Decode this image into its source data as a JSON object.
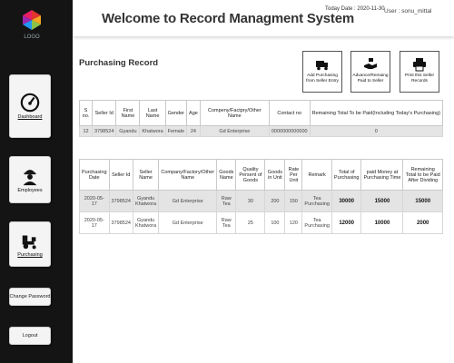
{
  "sidebar": {
    "logo_text": "LOGO",
    "items": [
      {
        "label": "Dashboard",
        "icon": "gauge-icon"
      },
      {
        "label": "Employees",
        "icon": "worker-icon"
      },
      {
        "label": "Purchasing",
        "icon": "tractor-icon"
      },
      {
        "label": "Change Password"
      },
      {
        "label": "Logout"
      }
    ]
  },
  "header": {
    "title": "Welcome to Record Managment System",
    "today": "Today Date : 2020-11-30",
    "user": "User : sonu_mittal"
  },
  "page": {
    "section_title": "Purchasing Record",
    "actions": [
      {
        "label": "Add Purchasing from Seller Entry",
        "icon": "truck-icon"
      },
      {
        "label": "Advance/Remaing Paid to Seller",
        "icon": "handshake-icon"
      },
      {
        "label": "Print this Seller Records",
        "icon": "printer-icon"
      }
    ]
  },
  "seller_table": {
    "headers": [
      "S no.",
      "Seller Id",
      "First Name",
      "Last Name",
      "Gender",
      "Age",
      "Compeny/Factpry/Other Name",
      "Contact no",
      "Remaining Total To be Paid(Including Today's Purchasing)"
    ],
    "rows": [
      [
        "12",
        "3798524",
        "Gyandu",
        "Khatwora",
        "Female",
        "24",
        "Gd Enterprise",
        "0000000000000",
        "0"
      ]
    ]
  },
  "purchase_table": {
    "headers": [
      "Purchasing Date",
      "Seller Id",
      "Seller Name",
      "Company/Factory/Other Name",
      "Goods Name",
      "Quality Persent of Goods",
      "Goods in Unit",
      "Rate Per Unit",
      "Remark",
      "Total of Purchasing",
      "paid Money at Purchasing Time",
      "Remaining Total to be Paid After Dividing"
    ],
    "rows": [
      [
        "2020-05-17",
        "3798524",
        "Gyandu Khatwora",
        "Gd Enterprise",
        "Raw Tea",
        "30",
        "200",
        "150",
        "Tea Purchasing",
        "30000",
        "15000",
        "15000"
      ],
      [
        "2020-05-17",
        "3798524",
        "Gyandu Khatwora",
        "Gd Enterprise",
        "Raw Tea",
        "25",
        "100",
        "120",
        "Tea Purchasing",
        "12000",
        "10000",
        "2000"
      ]
    ]
  }
}
